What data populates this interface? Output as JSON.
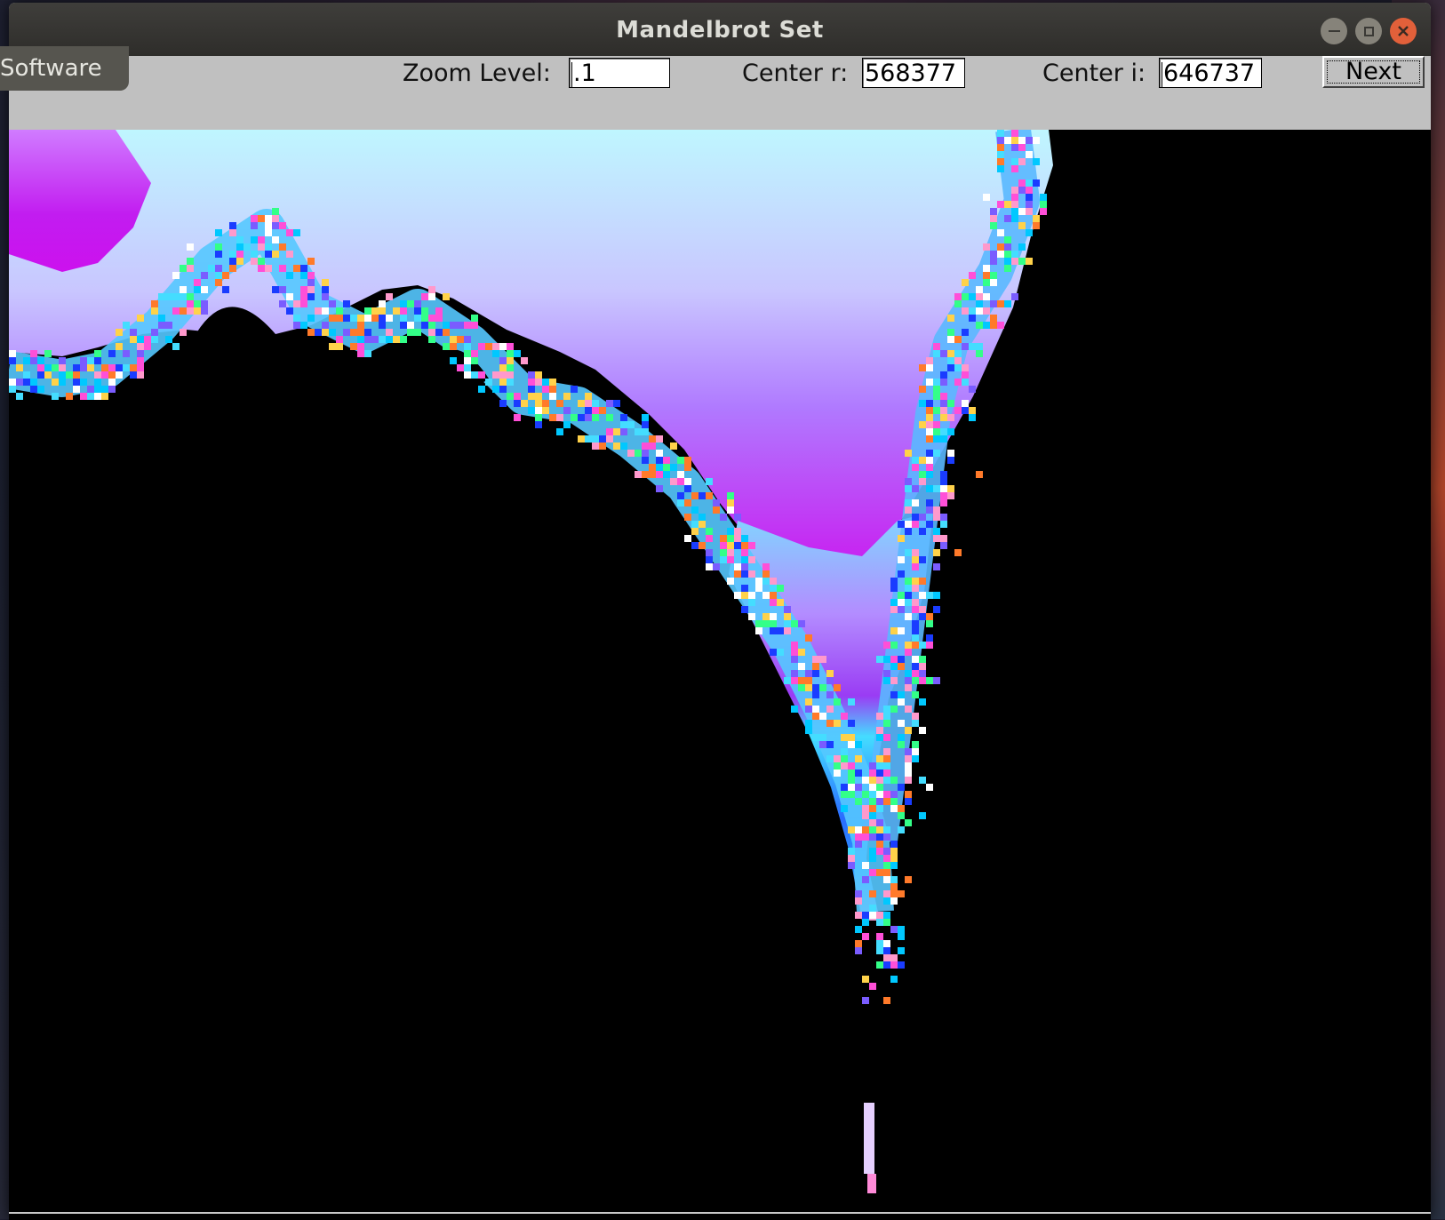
{
  "window": {
    "title": "Mandelbrot Set",
    "buttons": {
      "minimize": "minimize-icon",
      "maximize": "maximize-icon",
      "close": "close-icon"
    }
  },
  "overlay": {
    "software_label": "Software"
  },
  "toolbar": {
    "zoom_label": "Zoom Level:",
    "zoom_value": ".1",
    "center_r_label": "Center r:",
    "center_r_value": "568377",
    "center_i_label": "Center i:",
    "center_i_value": "646737",
    "next_label": "Next"
  },
  "colors": {
    "background": "#000000",
    "magenta": "#cc11ee",
    "violet": "#aa66ff",
    "lavender": "#c8c8ff",
    "light_blue": "#b8e8ff",
    "cyan": "#44ddff",
    "blue": "#2255ff",
    "toolbar": "#c0c0c0",
    "close_button": "#e2603a"
  }
}
